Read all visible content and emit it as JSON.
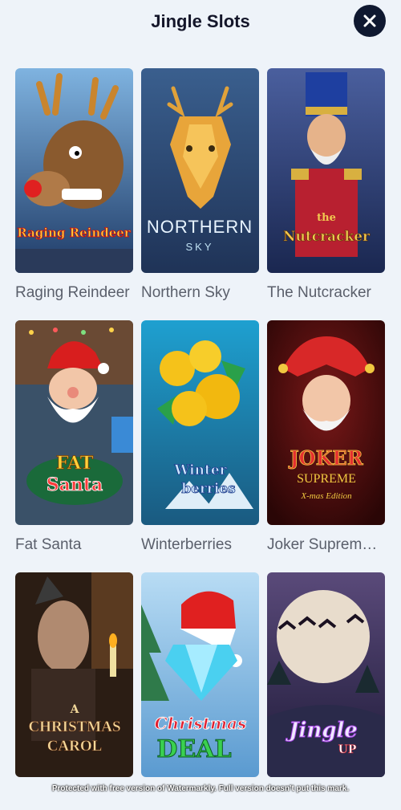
{
  "header": {
    "title": "Jingle Slots",
    "close_icon": "close-icon"
  },
  "games": [
    {
      "name": "Raging Reindeer",
      "logo": "Raging Reindeer",
      "theme": "#3a5b8c"
    },
    {
      "name": "Northern Sky",
      "logo_main": "NORTHERN",
      "logo_sub": "SKY",
      "theme": "#26507d"
    },
    {
      "name": "The Nutcracker",
      "logo_top": "the",
      "logo_main": "Nutcracker",
      "theme": "#2a3f74"
    },
    {
      "name": "Fat Santa",
      "logo_top": "FAT",
      "logo_main": "Santa",
      "theme": "#26486b"
    },
    {
      "name": "Winterberries",
      "logo_top": "Winter",
      "logo_main": "berries",
      "theme": "#1c79a8"
    },
    {
      "name": "Joker Supreme ...",
      "logo_top": "JOKER",
      "logo_main": "SUPREME",
      "logo_sub": "X-mas Edition",
      "theme": "#4a1010"
    },
    {
      "name": "",
      "logo_top": "A",
      "logo_main": "CHRISTMAS",
      "logo_sub": "CAROL",
      "theme": "#2b1d14"
    },
    {
      "name": "",
      "logo_top": "Christmas",
      "logo_main": "DEAL",
      "theme": "#8fc2e6"
    },
    {
      "name": "",
      "logo_top": "Jingle",
      "logo_main": "UP",
      "theme": "#3a2f58"
    }
  ],
  "watermark": "Protected with free version of Watermarkly. Full version doesn't put this mark."
}
